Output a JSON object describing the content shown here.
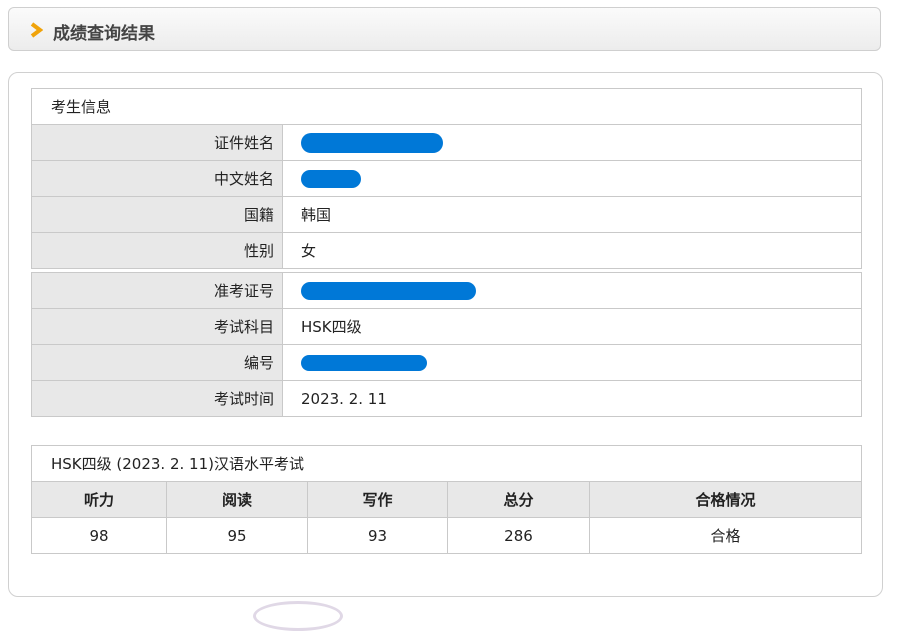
{
  "page": {
    "title": "成绩查询结果"
  },
  "info": {
    "section_title": "考生信息",
    "rows": [
      {
        "label": "证件姓名",
        "value": "",
        "redacted": true
      },
      {
        "label": "中文姓名",
        "value": "",
        "redacted": true
      },
      {
        "label": "国籍",
        "value": "韩国",
        "redacted": false
      },
      {
        "label": "性别",
        "value": "女",
        "redacted": false
      }
    ],
    "rows2": [
      {
        "label": "准考证号",
        "value": "",
        "redacted": true
      },
      {
        "label": "考试科目",
        "value": "HSK四级",
        "redacted": false
      },
      {
        "label": "编号",
        "value": "",
        "redacted": true
      },
      {
        "label": "考试时间",
        "value": "2023. 2. 11",
        "redacted": false
      }
    ]
  },
  "scores": {
    "caption": "HSK四级 (2023. 2. 11)汉语水平考试",
    "headers": [
      "听力",
      "阅读",
      "写作",
      "总分",
      "合格情况"
    ],
    "values": [
      "98",
      "95",
      "93",
      "286",
      "合格"
    ]
  },
  "colors": {
    "accent": "#f0a30a",
    "redaction": "#0078d7",
    "label_bg": "#e8e8e8"
  }
}
